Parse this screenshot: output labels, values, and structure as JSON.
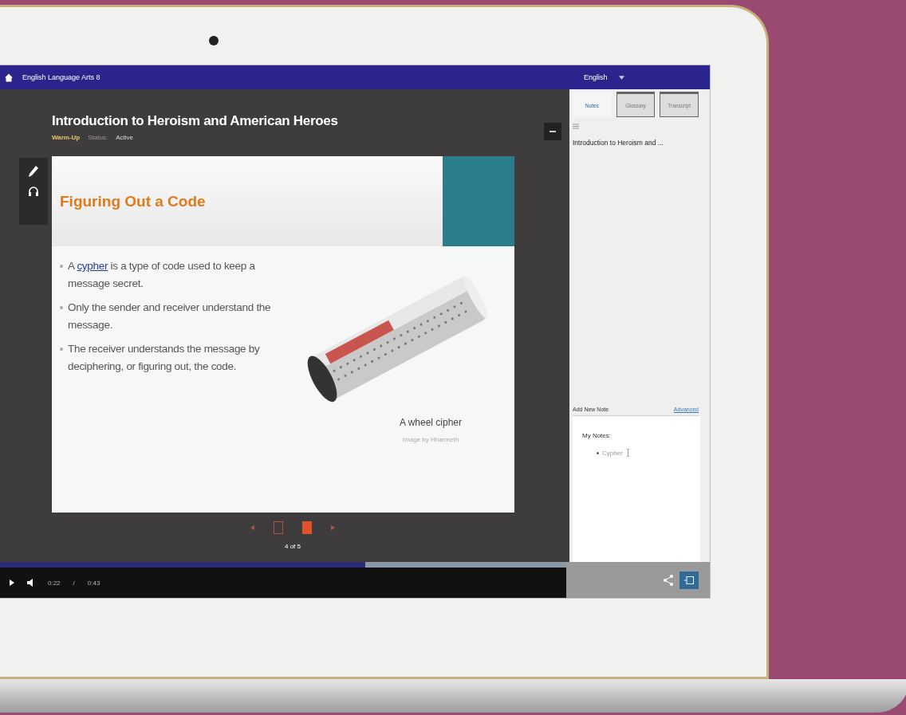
{
  "header": {
    "course": "English Language Arts 8",
    "language": "English"
  },
  "lesson": {
    "title": "Introduction to Heroism and American Heroes",
    "section": "Warm-Up",
    "status_label": "Status:",
    "status": "Active"
  },
  "slide": {
    "title": "Figuring Out a Code",
    "bullets": [
      {
        "lead": "A ",
        "link": "cypher",
        "text": " is a type of code used to keep a message secret."
      },
      {
        "text": "Only the sender and receiver understand the message."
      },
      {
        "text": "The receiver understands the message by deciphering, or figuring out, the code."
      }
    ],
    "caption": "A wheel cipher",
    "credit": "Image by Hharmeth"
  },
  "pager": {
    "pages": [
      {
        "selected": false
      },
      {
        "selected": true
      }
    ],
    "label": "4 of 5"
  },
  "player": {
    "level": 0.645,
    "current": "0:22",
    "separator": "/",
    "duration": "0:43"
  },
  "panel": {
    "tabs": [
      {
        "label": "Notes",
        "selected": true
      },
      {
        "label": "Glossary",
        "selected": false
      },
      {
        "label": "Transcript",
        "selected": false
      }
    ],
    "note_title": "Introduction to Heroism and ...",
    "add_note": "Add New Note",
    "advanced": "Advanced",
    "notes_heading": "My Notes:",
    "notes": [
      "Cypher"
    ]
  }
}
